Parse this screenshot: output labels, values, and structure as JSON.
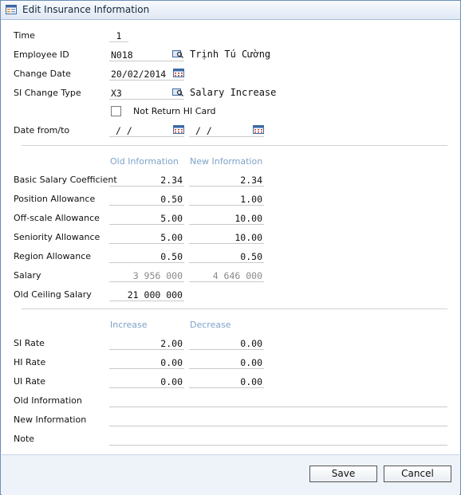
{
  "window": {
    "title": "Edit Insurance Information",
    "icon": "form-window-icon"
  },
  "form": {
    "time": {
      "label": "Time",
      "value": "1"
    },
    "employee_id": {
      "label": "Employee ID",
      "value": "N018",
      "name": "Trịnh Tú Cường",
      "icon": "lookup-icon"
    },
    "change_date": {
      "label": "Change Date",
      "value": "20/02/2014",
      "icon": "calendar-icon"
    },
    "si_change_type": {
      "label": "SI Change Type",
      "value": "X3",
      "description": "Salary Increase",
      "icon": "lookup-icon"
    },
    "not_return_hi_card": {
      "label": "Not Return HI Card",
      "checked": false
    },
    "date_from_to": {
      "label": "Date from/to",
      "from": "/ /",
      "to": "/ /",
      "icon": "calendar-icon"
    }
  },
  "salary_section": {
    "col_old": "Old Information",
    "col_new": "New Information",
    "rows": [
      {
        "label": "Basic Salary Coefficient",
        "old": "2.34",
        "new": "2.34"
      },
      {
        "label": "Position Allowance",
        "old": "0.50",
        "new": "1.00"
      },
      {
        "label": "Off-scale Allowance",
        "old": "5.00",
        "new": "10.00"
      },
      {
        "label": "Seniority Allowance",
        "old": "5.00",
        "new": "10.00"
      },
      {
        "label": "Region Allowance",
        "old": "0.50",
        "new": "0.50"
      },
      {
        "label": "Salary",
        "old": "3 956 000",
        "new": "4 646 000"
      }
    ],
    "old_ceiling_salary": {
      "label": "Old Ceiling Salary",
      "value": "21 000 000"
    }
  },
  "rate_section": {
    "col_increase": "Increase",
    "col_decrease": "Decrease",
    "rows": [
      {
        "label": "SI Rate",
        "increase": "2.00",
        "decrease": "0.00"
      },
      {
        "label": "HI Rate",
        "increase": "0.00",
        "decrease": "0.00"
      },
      {
        "label": "UI Rate",
        "increase": "0.00",
        "decrease": "0.00"
      }
    ],
    "old_information": {
      "label": "Old Information",
      "value": ""
    },
    "new_information": {
      "label": "New Information",
      "value": ""
    },
    "note": {
      "label": "Note",
      "value": ""
    }
  },
  "buttons": {
    "save": "Save",
    "cancel": "Cancel"
  },
  "colors": {
    "section_header": "#7ea2c8",
    "window_border": "#6e8fb8",
    "footer_bg": "#eef3fa",
    "disabled_text": "#8a8a8a"
  }
}
